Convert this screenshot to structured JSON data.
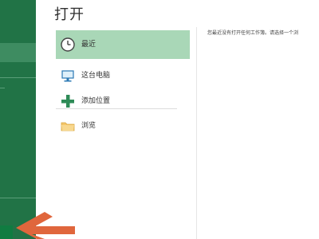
{
  "window": {
    "title": "打开"
  },
  "locations": [
    {
      "label": "最近",
      "icon": "clock-icon",
      "selected": true
    },
    {
      "label": "这台电脑",
      "icon": "computer-icon",
      "selected": false
    },
    {
      "label": "添加位置",
      "icon": "plus-icon",
      "selected": false
    },
    {
      "label": "浏览",
      "icon": "folder-icon",
      "selected": false
    }
  ],
  "main": {
    "empty_message": "您最近没有打开任何工作簿。请选择一个浏"
  },
  "colors": {
    "rail": "#217346",
    "selected": "#a9d7b7",
    "pointer": "#e0663c"
  }
}
